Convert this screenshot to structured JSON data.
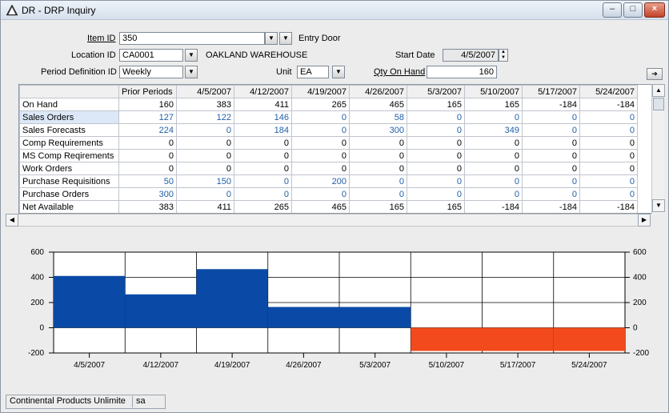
{
  "window": {
    "title": "DR - DRP Inquiry",
    "icon": "warning-triangle-icon"
  },
  "header": {
    "item_id_label": "Item ID",
    "item_id_value": "350",
    "item_desc": "Entry Door",
    "location_label": "Location ID",
    "location_value": "CA0001",
    "location_desc": "OAKLAND WAREHOUSE",
    "period_label": "Period Definition ID",
    "period_value": "Weekly",
    "unit_label": "Unit",
    "unit_value": "EA",
    "start_date_label": "Start Date",
    "start_date_value": "4/5/2007",
    "qty_label": "Qty On Hand",
    "qty_value": "160"
  },
  "grid": {
    "columns": [
      "Prior Periods",
      "4/5/2007",
      "4/12/2007",
      "4/19/2007",
      "4/26/2007",
      "5/3/2007",
      "5/10/2007",
      "5/17/2007",
      "5/24/2007"
    ],
    "rows": [
      {
        "label": "On Hand",
        "values": [
          "160",
          "383",
          "411",
          "265",
          "465",
          "165",
          "165",
          "-184",
          "-184"
        ],
        "blue": false
      },
      {
        "label": "Sales Orders",
        "values": [
          "127",
          "122",
          "146",
          "0",
          "58",
          "0",
          "0",
          "0",
          "0"
        ],
        "blue": true
      },
      {
        "label": "Sales Forecasts",
        "values": [
          "224",
          "0",
          "184",
          "0",
          "300",
          "0",
          "349",
          "0",
          "0"
        ],
        "blue": true
      },
      {
        "label": "Comp Requirements",
        "values": [
          "0",
          "0",
          "0",
          "0",
          "0",
          "0",
          "0",
          "0",
          "0"
        ],
        "blue": false
      },
      {
        "label": "MS Comp Reqirements",
        "values": [
          "0",
          "0",
          "0",
          "0",
          "0",
          "0",
          "0",
          "0",
          "0"
        ],
        "blue": false
      },
      {
        "label": "Work Orders",
        "values": [
          "0",
          "0",
          "0",
          "0",
          "0",
          "0",
          "0",
          "0",
          "0"
        ],
        "blue": false
      },
      {
        "label": "Purchase Requisitions",
        "values": [
          "50",
          "150",
          "0",
          "200",
          "0",
          "0",
          "0",
          "0",
          "0"
        ],
        "blue": true
      },
      {
        "label": "Purchase Orders",
        "values": [
          "300",
          "0",
          "0",
          "0",
          "0",
          "0",
          "0",
          "0",
          "0"
        ],
        "blue": true
      },
      {
        "label": "Net Available",
        "values": [
          "383",
          "411",
          "265",
          "465",
          "165",
          "165",
          "-184",
          "-184",
          "-184"
        ],
        "blue": false
      }
    ]
  },
  "chart_data": {
    "type": "bar",
    "categories": [
      "4/5/2007",
      "4/12/2007",
      "4/19/2007",
      "4/26/2007",
      "5/3/2007",
      "5/10/2007",
      "5/17/2007",
      "5/24/2007"
    ],
    "values": [
      411,
      265,
      465,
      165,
      165,
      -184,
      -184,
      -184
    ],
    "ylim": [
      -200,
      600
    ],
    "yticks": [
      "600",
      "400",
      "200",
      "0",
      "-200"
    ],
    "positive_color": "#0a4aa6",
    "negative_color": "#f24a1c",
    "grid": true
  },
  "status": {
    "company": "Continental Products Unlimite",
    "user": "sa"
  }
}
